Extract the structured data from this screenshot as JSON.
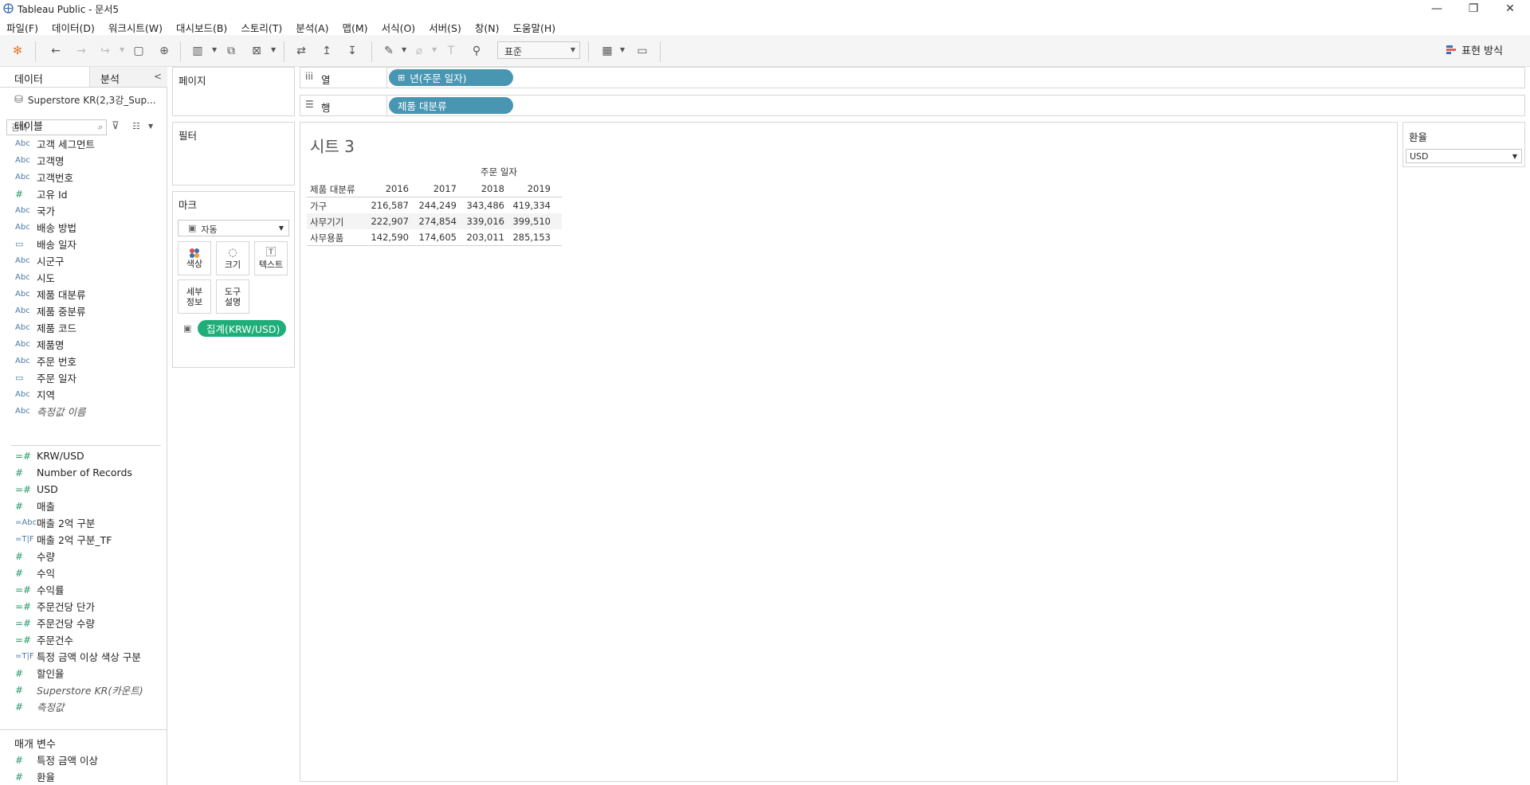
{
  "window": {
    "title": "Tableau Public - 문서5",
    "minimize": "—",
    "maximize": "❐",
    "close": "✕"
  },
  "menu": [
    "파일(F)",
    "데이터(D)",
    "워크시트(W)",
    "대시보드(B)",
    "스토리(T)",
    "분석(A)",
    "맵(M)",
    "서식(O)",
    "서버(S)",
    "창(N)",
    "도움말(H)"
  ],
  "toolbar": {
    "fit_select": "표준",
    "show_me": "표현 방식"
  },
  "left_panel": {
    "tab_data": "데이터",
    "tab_analysis": "분석",
    "datasource": "Superstore KR(2,3강_Sup...",
    "search_placeholder": "검색",
    "tables_header": "테이블",
    "dimensions": [
      {
        "type": "Abc",
        "name": "고객 세그먼트"
      },
      {
        "type": "Abc",
        "name": "고객명"
      },
      {
        "type": "Abc",
        "name": "고객번호"
      },
      {
        "type": "#",
        "name": "고유 Id"
      },
      {
        "type": "Abc",
        "name": "국가"
      },
      {
        "type": "Abc",
        "name": "배송 방법"
      },
      {
        "type": "date",
        "name": "배송 일자"
      },
      {
        "type": "Abc",
        "name": "시군구"
      },
      {
        "type": "Abc",
        "name": "시도"
      },
      {
        "type": "Abc",
        "name": "제품 대분류"
      },
      {
        "type": "Abc",
        "name": "제품 중분류"
      },
      {
        "type": "Abc",
        "name": "제품 코드"
      },
      {
        "type": "Abc",
        "name": "제품명"
      },
      {
        "type": "Abc",
        "name": "주문 번호"
      },
      {
        "type": "date",
        "name": "주문 일자"
      },
      {
        "type": "Abc",
        "name": "지역"
      },
      {
        "type": "Abc",
        "name": "측정값 이름",
        "italic": true
      }
    ],
    "measures": [
      {
        "type": "=#",
        "name": "KRW/USD"
      },
      {
        "type": "#",
        "name": "Number of Records"
      },
      {
        "type": "=#",
        "name": "USD"
      },
      {
        "type": "#",
        "name": "매출"
      },
      {
        "type": "=Abc",
        "name": "매출 2억 구분"
      },
      {
        "type": "=T|F",
        "name": "매출 2억 구분_TF"
      },
      {
        "type": "#",
        "name": "수량"
      },
      {
        "type": "#",
        "name": "수익"
      },
      {
        "type": "=#",
        "name": "수익률"
      },
      {
        "type": "=#",
        "name": "주문건당 단가"
      },
      {
        "type": "=#",
        "name": "주문건당 수량"
      },
      {
        "type": "=#",
        "name": "주문건수"
      },
      {
        "type": "=T|F",
        "name": "특정 금액 이상 색상 구분"
      },
      {
        "type": "#",
        "name": "할인율"
      },
      {
        "type": "#",
        "name": "Superstore KR(카운트)",
        "italic": true
      },
      {
        "type": "#",
        "name": "측정값",
        "italic": true
      }
    ],
    "params_header": "매개 변수",
    "parameters": [
      {
        "type": "#",
        "name": "특정 금액 이상"
      },
      {
        "type": "#",
        "name": "환율"
      }
    ]
  },
  "cards": {
    "pages": "페이지",
    "filters": "필터",
    "marks": "마크",
    "marks_type": "자동",
    "mark_color": "색상",
    "mark_size": "크기",
    "mark_text": "텍스트",
    "mark_detail_1": "세부",
    "mark_detail_2": "정보",
    "mark_tooltip_1": "도구",
    "mark_tooltip_2": "설명",
    "text_pill": "집계(KRW/USD)"
  },
  "shelves": {
    "columns_label": "열",
    "rows_label": "행",
    "columns_pill": "년(주문 일자)",
    "rows_pill": "제품 대분류"
  },
  "view": {
    "sheet_title": "시트 3",
    "column_header_top": "주문 일자",
    "row_header_label": "제품 대분류",
    "years": [
      "2016",
      "2017",
      "2018",
      "2019"
    ],
    "rows": [
      {
        "category": "가구",
        "values": [
          "216,587",
          "244,249",
          "343,486",
          "419,334"
        ]
      },
      {
        "category": "사무기기",
        "values": [
          "222,907",
          "274,854",
          "339,016",
          "399,510"
        ]
      },
      {
        "category": "사무용품",
        "values": [
          "142,590",
          "174,605",
          "203,011",
          "285,153"
        ]
      }
    ]
  },
  "parameter_control": {
    "title": "환율",
    "value": "USD"
  },
  "colors": {
    "blue_pill": "#4996b2",
    "green_pill": "#1fae7a"
  }
}
